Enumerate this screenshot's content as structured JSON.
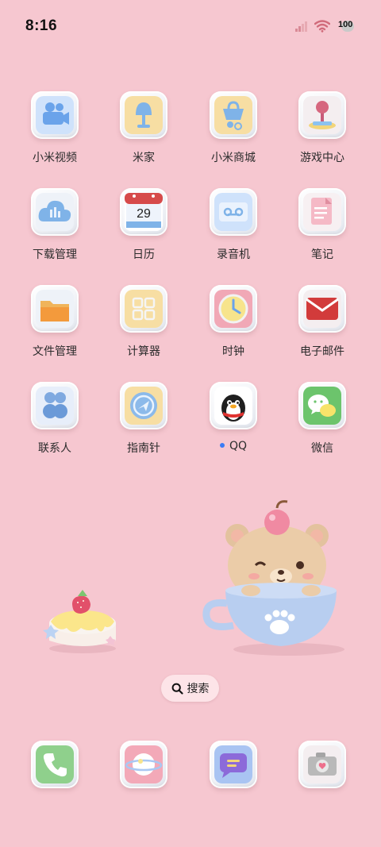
{
  "status_bar": {
    "time": "8:16",
    "battery": "100",
    "icons": [
      "signal-icon",
      "wifi-icon",
      "battery-icon"
    ]
  },
  "apps": [
    {
      "label": "小米视频",
      "icon": "video-camera-icon"
    },
    {
      "label": "米家",
      "icon": "lamp-icon"
    },
    {
      "label": "小米商城",
      "icon": "shopping-bag-icon"
    },
    {
      "label": "游戏中心",
      "icon": "joystick-icon"
    },
    {
      "label": "下载管理",
      "icon": "cloud-download-icon"
    },
    {
      "label": "日历",
      "icon": "calendar-icon",
      "badge": "29"
    },
    {
      "label": "录音机",
      "icon": "recorder-icon"
    },
    {
      "label": "笔记",
      "icon": "note-icon"
    },
    {
      "label": "文件管理",
      "icon": "folder-icon"
    },
    {
      "label": "计算器",
      "icon": "calculator-icon"
    },
    {
      "label": "时钟",
      "icon": "clock-icon"
    },
    {
      "label": "电子邮件",
      "icon": "mail-icon"
    },
    {
      "label": "联系人",
      "icon": "contacts-icon"
    },
    {
      "label": "指南针",
      "icon": "compass-icon"
    },
    {
      "label": "QQ",
      "icon": "penguin-icon",
      "new_indicator": true
    },
    {
      "label": "微信",
      "icon": "wechat-icon"
    }
  ],
  "search": {
    "label": "搜索"
  },
  "dock": [
    {
      "icon": "phone-icon"
    },
    {
      "icon": "browser-planet-icon"
    },
    {
      "icon": "messages-icon"
    },
    {
      "icon": "camera-icon"
    }
  ],
  "colors": {
    "wallpaper": "#f6c7d0",
    "accent_dot": "#3b7bf5"
  }
}
